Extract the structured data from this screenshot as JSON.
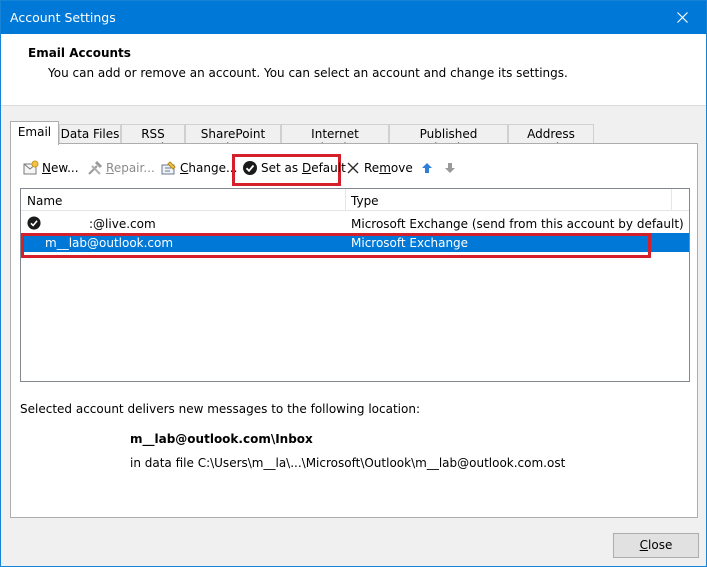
{
  "window": {
    "title": "Account Settings",
    "close_symbol": "✕"
  },
  "header": {
    "title": "Email Accounts",
    "description": "You can add or remove an account. You can select an account and change its settings."
  },
  "tabs": [
    {
      "label": "Email",
      "active": true
    },
    {
      "label": "Data Files",
      "active": false
    },
    {
      "label": "RSS Feeds",
      "active": false
    },
    {
      "label": "SharePoint Lists",
      "active": false
    },
    {
      "label": "Internet Calendars",
      "active": false
    },
    {
      "label": "Published Calendars",
      "active": false
    },
    {
      "label": "Address Books",
      "active": false
    }
  ],
  "toolbar": {
    "new_label_acc": "N",
    "new_label_rest": "ew...",
    "repair_label_acc": "R",
    "repair_label_rest": "epair...",
    "change_label_acc": "C",
    "change_label_rest": "hange...",
    "set_default_pre": "Set as ",
    "set_default_acc": "D",
    "set_default_post": "efault",
    "remove_pre": "Re",
    "remove_acc": "m",
    "remove_post": "ove"
  },
  "list": {
    "columns": {
      "name": "Name",
      "type": "Type"
    },
    "rows": [
      {
        "name": ":@live.com",
        "type": "Microsoft Exchange (send from this account by default)",
        "is_default": true,
        "selected": false
      },
      {
        "name": "m__lab@outlook.com",
        "type": "Microsoft Exchange",
        "is_default": false,
        "selected": true
      }
    ]
  },
  "delivery": {
    "intro": "Selected account delivers new messages to the following location:",
    "location": "m__lab@outlook.com\\Inbox",
    "data_file": "in data file C:\\Users\\m__la\\...\\Microsoft\\Outlook\\m__lab@outlook.com.ost"
  },
  "footer": {
    "close_acc": "C",
    "close_rest": "lose"
  },
  "colors": {
    "title_bar": "#0078d7",
    "selection": "#0078d7",
    "highlight_box": "#d4202b"
  }
}
